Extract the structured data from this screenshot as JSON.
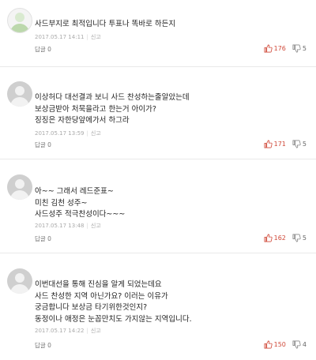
{
  "comments": [
    {
      "lines": [
        "사드부지로 최적입니다 투표나 똑바로 하든지"
      ],
      "date": "2017.05.17 14:11",
      "report": "신고",
      "reply_label": "답글 0",
      "likes": "176",
      "dislikes": "5"
    },
    {
      "lines": [
        "이상허다 대선결과 보니 사드 찬성하는줄알았는데",
        "보상금받아 처묵을라고 한는거 아이가?",
        "징징은 자한당앞에가서 하그라"
      ],
      "date": "2017.05.17 13:59",
      "report": "신고",
      "reply_label": "답글 0",
      "likes": "171",
      "dislikes": "5"
    },
    {
      "lines": [
        "아~~ 그래서 레드준표~",
        "미친 김천 성주~",
        "사드성주 적극찬성이다~~~"
      ],
      "date": "2017.05.17 13:48",
      "report": "신고",
      "reply_label": "답글 0",
      "likes": "162",
      "dislikes": "5"
    },
    {
      "lines": [
        "이번대선을 통해 진심을 알게 되었는데요",
        "사드 찬성한 지역 아닌가요? 이러는 이유가",
        "궁금합니다 보상금  타기위한것인지?",
        "동정이나 애정은 눈꼽만치도 가지않는 지역입니다."
      ],
      "date": "2017.05.17 14:22",
      "report": "신고",
      "reply_label": "답글 0",
      "likes": "150",
      "dislikes": "4"
    }
  ]
}
